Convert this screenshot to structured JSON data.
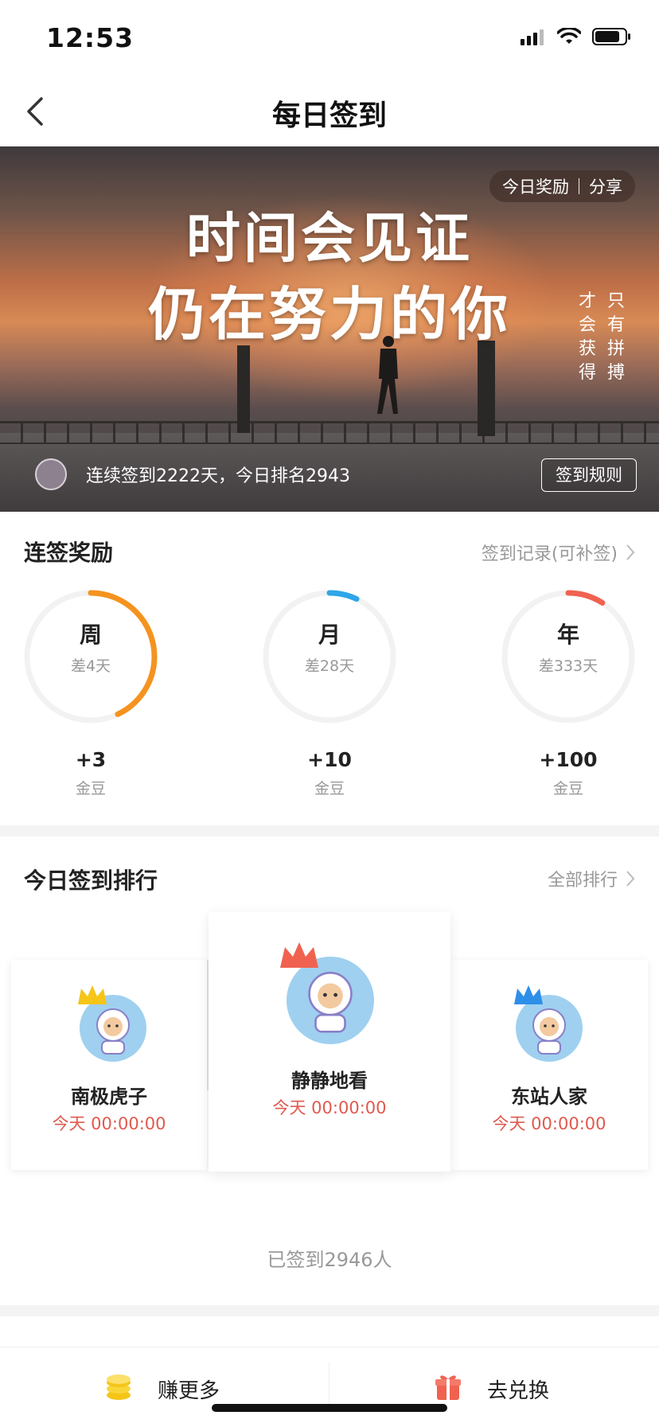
{
  "status_bar": {
    "time": "12:53"
  },
  "nav": {
    "title": "每日签到"
  },
  "banner": {
    "headline_line1": "时间会见证",
    "headline_line2": "仍在努力的你",
    "vertical_col1": [
      "只",
      "有",
      "拼",
      "搏"
    ],
    "vertical_col2": [
      "才",
      "会",
      "获",
      "得"
    ],
    "today_reward": "今日奖励",
    "share": "分享",
    "streak_text": "连续签到2222天，今日排名2943",
    "rules_button": "签到规则"
  },
  "streak_rewards": {
    "title": "连签奖励",
    "record_link": "签到记录(可补签)",
    "items": [
      {
        "period": "周",
        "remaining": "差4天",
        "bonus": "+3",
        "unit": "金豆",
        "progress": 0.43,
        "color": "#f5931f"
      },
      {
        "period": "月",
        "remaining": "差28天",
        "bonus": "+10",
        "unit": "金豆",
        "progress": 0.07,
        "color": "#2ea7e8"
      },
      {
        "period": "年",
        "remaining": "差333天",
        "bonus": "+100",
        "unit": "金豆",
        "progress": 0.09,
        "color": "#f0624f"
      }
    ]
  },
  "ranking": {
    "title": "今日签到排行",
    "all_link": "全部排行",
    "top": [
      {
        "name": "静静地看",
        "time": "今天 00:00:00",
        "crown": "#f0624f"
      },
      {
        "name": "南极虎子",
        "time": "今天 00:00:00",
        "crown": "#f5c518"
      },
      {
        "name": "东站人家",
        "time": "今天 00:00:00",
        "crown": "#2e8fe8"
      }
    ],
    "total": "已签到2946人"
  },
  "bottom_tabs": {
    "earn": "赚更多",
    "exchange": "去兑换"
  }
}
